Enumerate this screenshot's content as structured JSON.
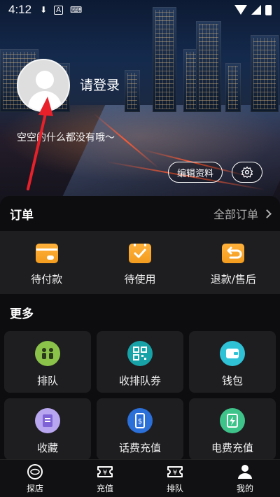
{
  "status_bar": {
    "time": "4:12"
  },
  "profile": {
    "login_label": "请登录",
    "bio": "空空的什么都没有哦～",
    "edit_label": "编辑资料"
  },
  "orders": {
    "title": "订单",
    "all_label": "全部订单",
    "items": [
      {
        "label": "待付款",
        "icon": "card-icon"
      },
      {
        "label": "待使用",
        "icon": "check-box-icon"
      },
      {
        "label": "退款/售后",
        "icon": "refund-icon"
      }
    ]
  },
  "more": {
    "title": "更多",
    "items": [
      {
        "label": "排队",
        "icon": "queue-people-icon",
        "color": "#8bc34a"
      },
      {
        "label": "收排队券",
        "icon": "qr-code-icon",
        "color": "#17a2a8"
      },
      {
        "label": "钱包",
        "icon": "wallet-icon",
        "color": "#2fc2d6"
      },
      {
        "label": "收藏",
        "icon": "favorite-doc-icon",
        "color": "#b9a6f0"
      },
      {
        "label": "话费充值",
        "icon": "phone-recharge-icon",
        "color": "#2b6fd8"
      },
      {
        "label": "电费充值",
        "icon": "electric-recharge-icon",
        "color": "#3ec48a"
      }
    ]
  },
  "tabbar": {
    "items": [
      {
        "label": "探店",
        "icon": "explore-icon"
      },
      {
        "label": "充值",
        "icon": "ticket-yen-icon"
      },
      {
        "label": "排队",
        "icon": "ticket-yen-icon"
      },
      {
        "label": "我的",
        "icon": "person-icon"
      }
    ]
  },
  "colors": {
    "accent_orange": "#f5a623",
    "panel_bg": "#1e1e21",
    "arrow_red": "#e8202a"
  }
}
